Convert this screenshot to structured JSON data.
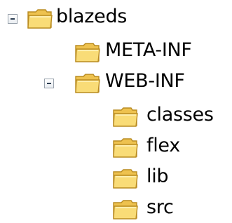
{
  "tree": {
    "nodes": [
      {
        "label": "blazeds",
        "icon": "folder-icon",
        "expanded": true
      },
      {
        "label": "META-INF",
        "icon": "folder-icon"
      },
      {
        "label": "WEB-INF",
        "icon": "folder-icon",
        "expanded": true
      },
      {
        "label": "classes",
        "icon": "folder-icon"
      },
      {
        "label": "flex",
        "icon": "folder-icon"
      },
      {
        "label": "lib",
        "icon": "folder-icon"
      },
      {
        "label": "src",
        "icon": "folder-icon"
      }
    ]
  },
  "colors": {
    "folder_body": "#f7d56a",
    "folder_shade": "#e9b53c",
    "folder_outline": "#b98b21"
  }
}
